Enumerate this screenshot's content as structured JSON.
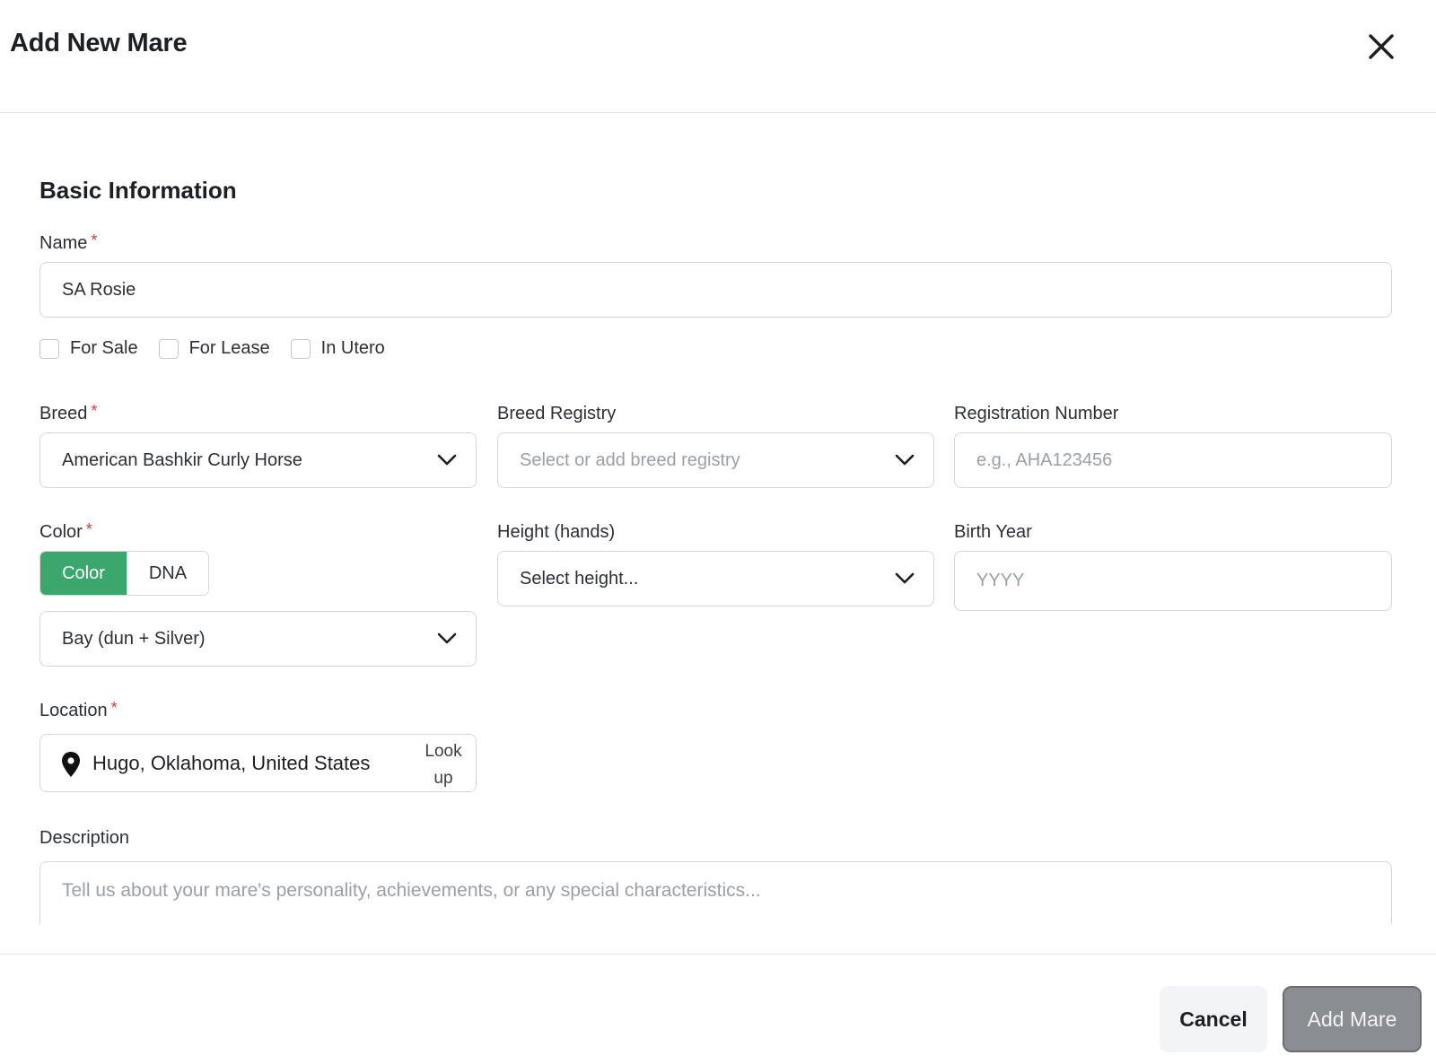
{
  "modal": {
    "title": "Add New Mare"
  },
  "section": {
    "title": "Basic Information"
  },
  "name": {
    "label": "Name",
    "required_mark": "*",
    "value": "SA Rosie"
  },
  "flags": [
    {
      "label": "For Sale",
      "checked": false
    },
    {
      "label": "For Lease",
      "checked": false
    },
    {
      "label": "In Utero",
      "checked": false
    }
  ],
  "breed": {
    "label": "Breed",
    "required_mark": "*",
    "value": "American Bashkir Curly Horse"
  },
  "breed_registry": {
    "label": "Breed Registry",
    "placeholder": "Select or add breed registry"
  },
  "registration_number": {
    "label": "Registration Number",
    "placeholder": "e.g., AHA123456"
  },
  "color": {
    "label": "Color",
    "required_mark": "*",
    "toggle": {
      "active": "Color",
      "inactive": "DNA"
    },
    "value": "Bay (dun + Silver)"
  },
  "height": {
    "label": "Height (hands)",
    "value": "Select height..."
  },
  "birth_year": {
    "label": "Birth Year",
    "placeholder": "YYYY"
  },
  "location": {
    "label": "Location",
    "required_mark": "*",
    "value": "Hugo, Oklahoma, United States",
    "lookup_line1": "Look",
    "lookup_line2": "up"
  },
  "description": {
    "label": "Description",
    "placeholder": "Tell us about your mare's personality, achievements, or any special characteristics..."
  },
  "footer": {
    "cancel_label": "Cancel",
    "submit_label": "Add Mare"
  },
  "colors": {
    "accent_green": "#3aa76d",
    "required_red": "#d63b3b",
    "submit_disabled_gray": "#8a8d91"
  },
  "icons": {
    "close": "close-icon",
    "chevron": "chevron-down-icon",
    "location": "map-pin-icon"
  }
}
